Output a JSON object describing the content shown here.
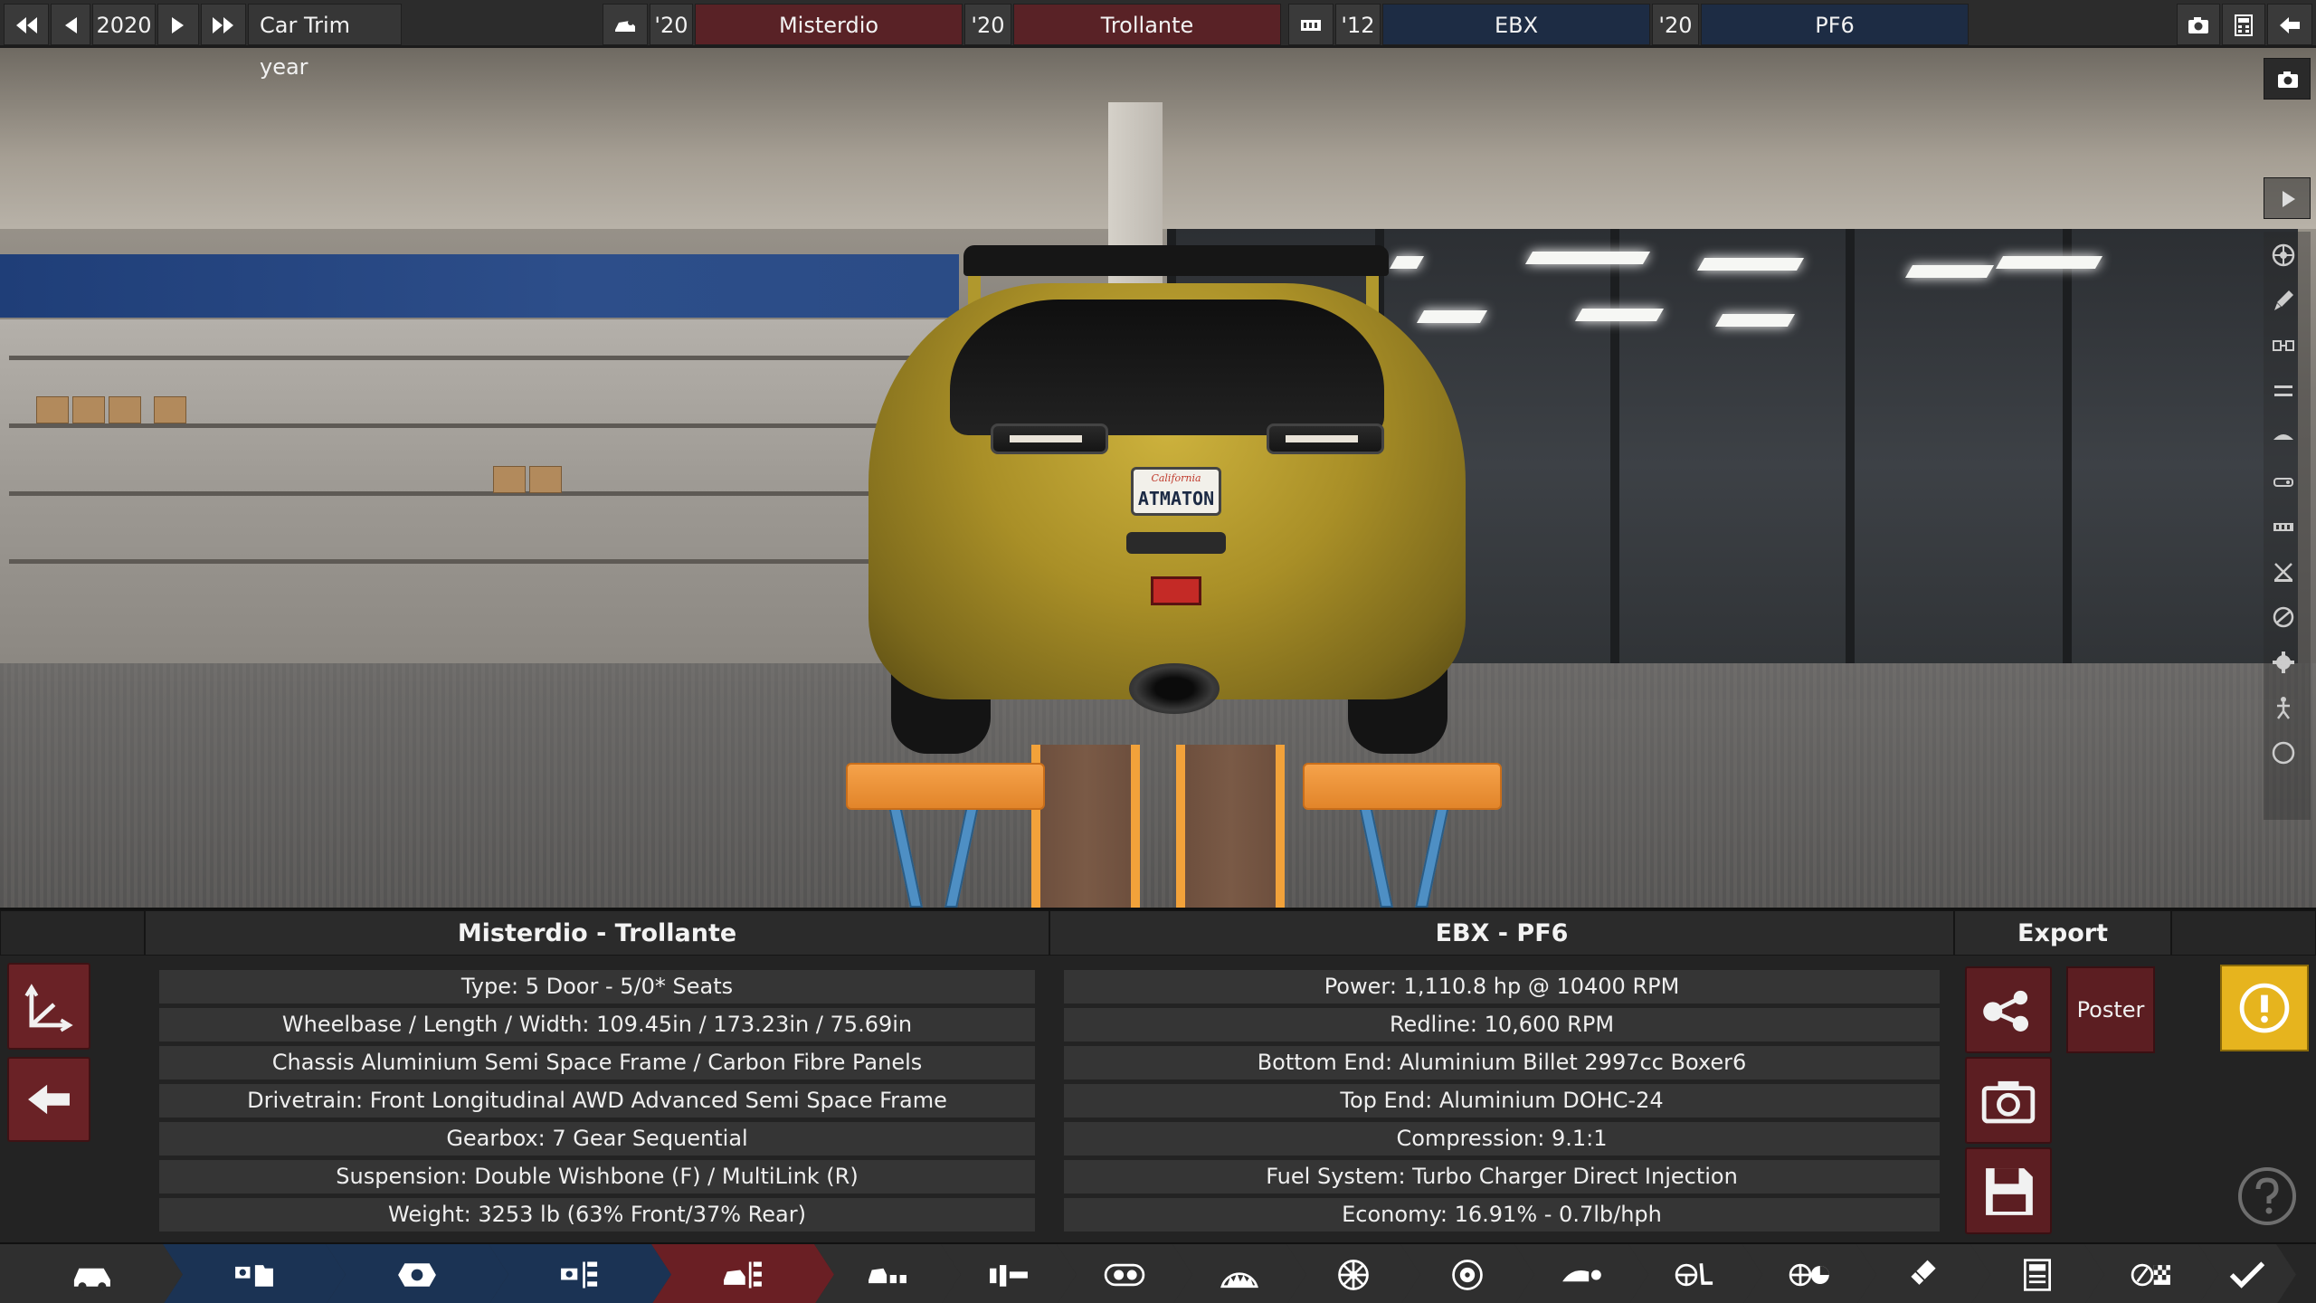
{
  "topbar": {
    "year": "2020",
    "trim_year_label": "Car Trim year",
    "model_year": "'20",
    "model_name": "Misterdio",
    "trim_year": "'20",
    "trim_name": "Trollante",
    "engine_family_year": "'12",
    "engine_family_name": "EBX",
    "engine_variant_year": "'20",
    "engine_variant_name": "PF6",
    "icons": [
      "rewind-icon",
      "previous-icon",
      "next-icon",
      "fast-forward-icon",
      "car-model-icon",
      "engine-block-icon",
      "camera-icon",
      "calculator-icon",
      "back-arrow-icon"
    ]
  },
  "scene": {
    "plate_state": "California",
    "plate_text": "ATMATON"
  },
  "rightbar": {
    "icons": [
      "camera-icon",
      "play-icon",
      "wheel-icon",
      "paint-brush-icon",
      "part-icon",
      "suspension-icon",
      "body-icon",
      "fixture-icon",
      "interior-icon",
      "tuning-icon",
      "brake-icon",
      "settings-icon",
      "person-icon",
      "circle-icon"
    ]
  },
  "panel": {
    "car_header": "Misterdio - Trollante",
    "engine_header": "EBX - PF6",
    "export_header": "Export",
    "car_info": [
      "Type: 5 Door - 5/0* Seats",
      "Wheelbase / Length / Width: 109.45in / 173.23in / 75.69in",
      "Chassis Aluminium Semi Space Frame / Carbon Fibre Panels",
      "Drivetrain: Front Longitudinal AWD Advanced Semi Space Frame",
      "Gearbox: 7 Gear Sequential",
      "Suspension: Double Wishbone (F) / MultiLink (R)",
      "Weight: 3253 lb (63% Front/37% Rear)"
    ],
    "engine_info": [
      "Power: 1,110.8 hp @ 10400 RPM",
      "Redline:  10,600 RPM",
      "Bottom End: Aluminium Billet 2997cc Boxer6",
      "Top End: Aluminium DOHC-24",
      "Compression: 9.1:1",
      "Fuel System: Turbo Charger Direct Injection",
      "Economy: 16.91% - 0.7lb/hph"
    ],
    "poster_label": "Poster",
    "warning_icon": "exclamation-icon",
    "help_icon": "question-icon",
    "side_icons": [
      "axis-icon",
      "back-arrow-icon"
    ],
    "export_icons": [
      "share-icon",
      "camera-icon",
      "save-icon"
    ]
  },
  "bottomnav": {
    "items": [
      {
        "icon": "car-icon",
        "state": "normal"
      },
      {
        "icon": "engine-folder-icon",
        "state": "blue"
      },
      {
        "icon": "engine-block-icon",
        "state": "blue"
      },
      {
        "icon": "engine-tree-icon",
        "state": "blue"
      },
      {
        "icon": "car-tree-icon",
        "state": "active"
      },
      {
        "icon": "car-models-icon",
        "state": "normal"
      },
      {
        "icon": "chassis-icon",
        "state": "normal"
      },
      {
        "icon": "drivetrain-icon",
        "state": "normal"
      },
      {
        "icon": "suspension-icon",
        "state": "normal"
      },
      {
        "icon": "wheel-icon",
        "state": "normal"
      },
      {
        "icon": "brake-disc-icon",
        "state": "normal"
      },
      {
        "icon": "aero-icon",
        "state": "normal"
      },
      {
        "icon": "interior-icon",
        "state": "normal"
      },
      {
        "icon": "tuning-icon",
        "state": "normal"
      },
      {
        "icon": "paint-icon",
        "state": "normal"
      },
      {
        "icon": "calculator-icon",
        "state": "normal"
      },
      {
        "icon": "test-track-icon",
        "state": "normal"
      },
      {
        "icon": "finish-check-icon",
        "state": "normal"
      }
    ]
  },
  "colors": {
    "active_red": "#6a1f24",
    "engine_blue": "#1b3354",
    "warning_yellow": "#e6b41e"
  }
}
